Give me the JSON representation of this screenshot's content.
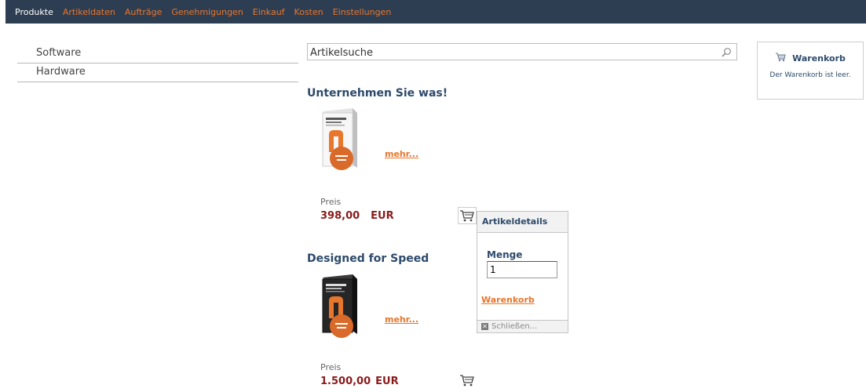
{
  "nav": {
    "items": [
      {
        "label": "Produkte",
        "active": true
      },
      {
        "label": "Artikeldaten",
        "active": false
      },
      {
        "label": "Aufträge",
        "active": false
      },
      {
        "label": "Genehmigungen",
        "active": false
      },
      {
        "label": "Einkauf",
        "active": false
      },
      {
        "label": "Kosten",
        "active": false
      },
      {
        "label": "Einstellungen",
        "active": false
      }
    ]
  },
  "sidebar": {
    "items": [
      {
        "label": "Software"
      },
      {
        "label": "Hardware"
      }
    ]
  },
  "search": {
    "value": "Artikelsuche",
    "icon": "search-icon"
  },
  "cart": {
    "title": "Warenkorb",
    "empty_text": "Der Warenkorb ist leer."
  },
  "products": [
    {
      "title": "Unternehmen Sie was!",
      "more_label": "mehr...",
      "price_label": "Preis",
      "price": "398,00",
      "currency": "EUR"
    },
    {
      "title": "Designed for Speed",
      "more_label": "mehr...",
      "price_label": "Preis",
      "price": "1.500,00",
      "currency": "EUR"
    }
  ],
  "popup": {
    "title": "Artikeldetails",
    "qty_label": "Menge",
    "qty_value": "1",
    "cart_link": "Warenkorb",
    "close_label": "Schließen..."
  },
  "colors": {
    "nav_bg": "#2d3e52",
    "accent": "#e8762d",
    "heading": "#2d4a6b",
    "price": "#8b1a1a"
  }
}
